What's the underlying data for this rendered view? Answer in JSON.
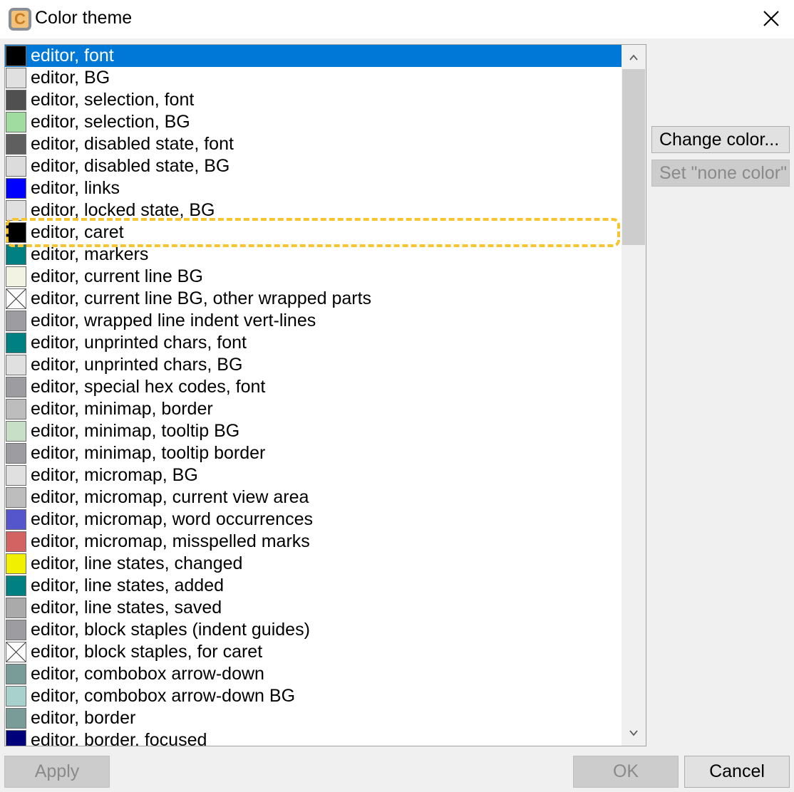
{
  "window": {
    "title": "Color theme",
    "app_icon_letter": "C"
  },
  "list": {
    "selected_index": 0,
    "highlighted_index": 6,
    "items": [
      {
        "label": "editor, font",
        "color": "#000000"
      },
      {
        "label": "editor, BG",
        "color": "#e0e0e0"
      },
      {
        "label": "editor, selection, font",
        "color": "#505050"
      },
      {
        "label": "editor, selection, BG",
        "color": "#a0dba0"
      },
      {
        "label": "editor, disabled state, font",
        "color": "#5f5f5f"
      },
      {
        "label": "editor, disabled state, BG",
        "color": "#dcdcdc"
      },
      {
        "label": "editor, links",
        "color": "#0000ff"
      },
      {
        "label": "editor, locked state, BG",
        "color": "#e0e0e0"
      },
      {
        "label": "editor, caret",
        "color": "#000000"
      },
      {
        "label": "editor, markers",
        "color": "#008080"
      },
      {
        "label": "editor, current line BG",
        "color": "#f2f3e3"
      },
      {
        "label": "editor, current line BG, other wrapped parts",
        "color": "none"
      },
      {
        "label": "editor, wrapped line indent vert-lines",
        "color": "#9d9da1"
      },
      {
        "label": "editor, unprinted chars, font",
        "color": "#008080"
      },
      {
        "label": "editor, unprinted chars, BG",
        "color": "#e0e0e0"
      },
      {
        "label": "editor, special hex codes, font",
        "color": "#9d9da1"
      },
      {
        "label": "editor, minimap, border",
        "color": "#bdbdbd"
      },
      {
        "label": "editor, minimap, tooltip BG",
        "color": "#c7dfc6"
      },
      {
        "label": "editor, minimap, tooltip border",
        "color": "#9d9da1"
      },
      {
        "label": "editor, micromap, BG",
        "color": "#e0e0e0"
      },
      {
        "label": "editor, micromap, current view area",
        "color": "#bdbdbd"
      },
      {
        "label": "editor, micromap, word occurrences",
        "color": "#5555cc"
      },
      {
        "label": "editor, micromap, misspelled marks",
        "color": "#d36363"
      },
      {
        "label": "editor, line states, changed",
        "color": "#f0f000"
      },
      {
        "label": "editor, line states, added",
        "color": "#008080"
      },
      {
        "label": "editor, line states, saved",
        "color": "#aaaaaa"
      },
      {
        "label": "editor, block staples (indent guides)",
        "color": "#9d9da1"
      },
      {
        "label": "editor, block staples, for caret",
        "color": "none"
      },
      {
        "label": "editor, combobox arrow-down",
        "color": "#7a9c99"
      },
      {
        "label": "editor, combobox arrow-down BG",
        "color": "#a8d0cc"
      },
      {
        "label": "editor, border",
        "color": "#7a9c99"
      },
      {
        "label": "editor, border, focused",
        "color": "#00007a"
      }
    ]
  },
  "buttons": {
    "change_color": "Change color...",
    "set_none_color": "Set \"none color\"",
    "apply": "Apply",
    "ok": "OK",
    "cancel": "Cancel"
  }
}
